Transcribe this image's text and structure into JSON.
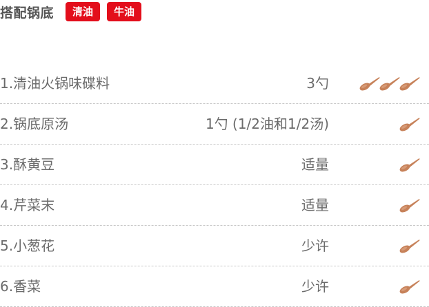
{
  "header": {
    "title": "搭配锅底",
    "tags": [
      "清油",
      "牛油"
    ]
  },
  "colors": {
    "tag_bg": "#e30e1b",
    "text": "#6b6b6b",
    "spoon": "#c7825a"
  },
  "rows": [
    {
      "name": "1.清油火锅味碟料",
      "amount": "3勺",
      "spoons": 3
    },
    {
      "name": "2.锅底原汤",
      "amount": "1勺 (1/2油和1/2汤)",
      "spoons": 1
    },
    {
      "name": "3.酥黄豆",
      "amount": "适量",
      "spoons": 1
    },
    {
      "name": "4.芹菜末",
      "amount": "适量",
      "spoons": 1
    },
    {
      "name": "5.小葱花",
      "amount": "少许",
      "spoons": 1
    },
    {
      "name": "6.香菜",
      "amount": "少许",
      "spoons": 1
    }
  ],
  "icons": {
    "spoon": "wooden-spoon-icon"
  }
}
